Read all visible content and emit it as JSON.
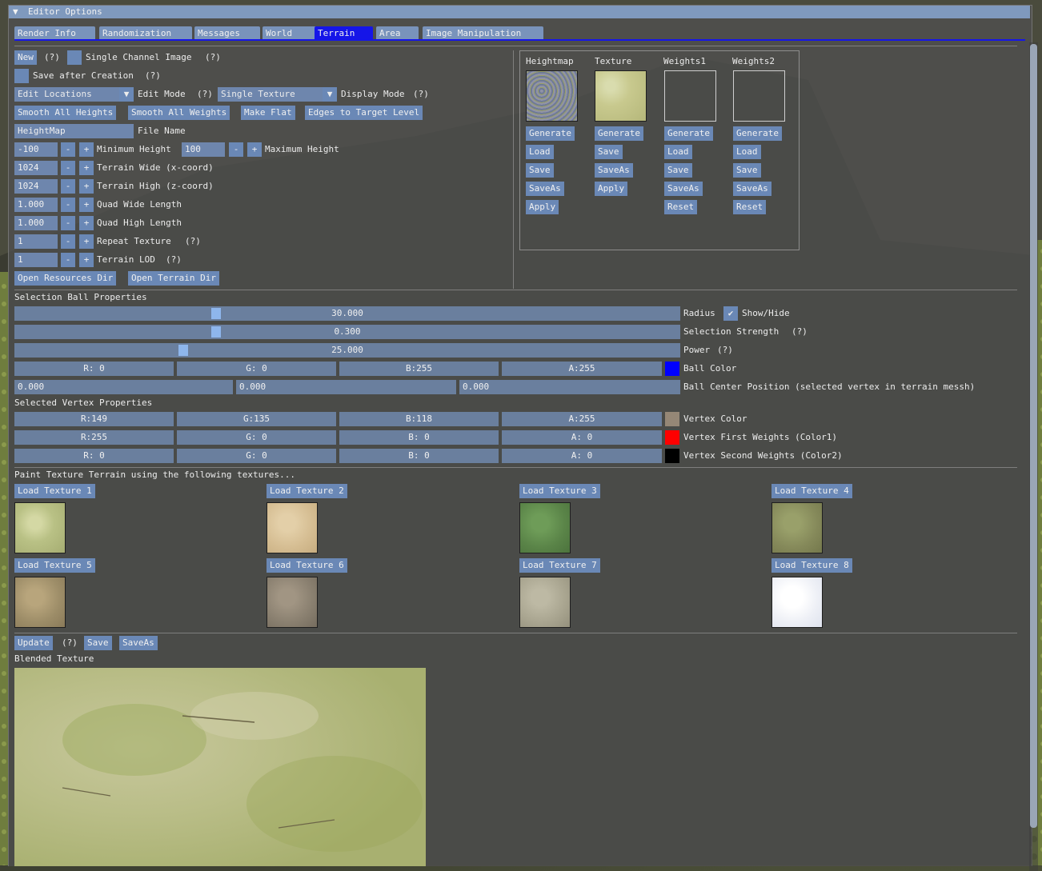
{
  "title": "Editor Options",
  "tabs": [
    "Render Info",
    "Randomization",
    "Messages",
    "World",
    "Terrain",
    "Area",
    "Image Manipulation"
  ],
  "active_tab": "Terrain",
  "toolbar": {
    "new": "New",
    "help": "(?)",
    "single_channel": "Single Channel Image",
    "save_after": "Save after Creation",
    "edit_mode_value": "Edit Locations",
    "edit_mode_label": "Edit Mode",
    "display_mode_value": "Single Texture",
    "display_mode_label": "Display Mode",
    "smooth_heights": "Smooth All Heights",
    "smooth_weights": "Smooth All Weights",
    "make_flat": "Make Flat",
    "edges": "Edges to Target Level",
    "file_name_value": "HeightMap",
    "file_name_label": "File Name",
    "minus": "-",
    "plus": "+"
  },
  "params": {
    "min_height": {
      "value": "-100",
      "label": "Minimum Height"
    },
    "max_height": {
      "value": "100",
      "label": "Maximum Height"
    },
    "wide": {
      "value": "1024",
      "label": "Terrain Wide (x-coord)"
    },
    "high": {
      "value": "1024",
      "label": "Terrain High (z-coord)"
    },
    "quad_wide": {
      "value": "1.000",
      "label": "Quad Wide Length"
    },
    "quad_high": {
      "value": "1.000",
      "label": "Quad High Length"
    },
    "repeat": {
      "value": "1",
      "label": "Repeat Texture"
    },
    "lod": {
      "value": "1",
      "label": "Terrain LOD"
    }
  },
  "dirs": {
    "resources": "Open Resources Dir",
    "terrain": "Open Terrain Dir"
  },
  "maps": {
    "heightmap": {
      "title": "Heightmap",
      "buttons": [
        "Generate",
        "Load",
        "Save",
        "SaveAs",
        "Apply"
      ]
    },
    "texture": {
      "title": "Texture",
      "buttons": [
        "Generate",
        "Save",
        "SaveAs",
        "Apply"
      ]
    },
    "weights1": {
      "title": "Weights1",
      "buttons": [
        "Generate",
        "Load",
        "Save",
        "SaveAs",
        "Reset"
      ]
    },
    "weights2": {
      "title": "Weights2",
      "buttons": [
        "Generate",
        "Load",
        "Save",
        "SaveAs",
        "Reset"
      ]
    }
  },
  "ball": {
    "header": "Selection Ball Properties",
    "radius": {
      "value": "30.000",
      "label": "Radius",
      "level": 0.3
    },
    "show_hide": "Show/Hide",
    "strength": {
      "value": "0.300",
      "label": "Selection Strength",
      "level": 0.3
    },
    "power": {
      "value": "25.000",
      "label": "Power",
      "level": 0.25
    },
    "color": {
      "r": "R:  0",
      "g": "G:  0",
      "b": "B:255",
      "a": "A:255",
      "label": "Ball Color",
      "hex": "#0000ff"
    },
    "center": {
      "x": "0.000",
      "y": "0.000",
      "z": "0.000",
      "label": "Ball Center Position (selected vertex in terrain messh)"
    }
  },
  "vertex": {
    "header": "Selected Vertex Properties",
    "color": {
      "r": "R:149",
      "g": "G:135",
      "b": "B:118",
      "a": "A:255",
      "label": "Vertex Color",
      "hex": "#958776"
    },
    "first": {
      "r": "R:255",
      "g": "G:  0",
      "b": "B:  0",
      "a": "A:  0",
      "label": "Vertex First Weights (Color1)",
      "hex": "#ff0000"
    },
    "second": {
      "r": "R:  0",
      "g": "G:  0",
      "b": "B:  0",
      "a": "A:  0",
      "label": "Vertex Second Weights (Color2)",
      "hex": "#000000"
    }
  },
  "paint": {
    "header": "Paint Texture Terrain using the following textures...",
    "textures": [
      "Load Texture 1",
      "Load Texture 2",
      "Load Texture 3",
      "Load Texture 4",
      "Load Texture 5",
      "Load Texture 6",
      "Load Texture 7",
      "Load Texture 8"
    ]
  },
  "blend": {
    "update": "Update",
    "save": "Save",
    "save_as": "SaveAs",
    "label": "Blended Texture"
  },
  "colors": {
    "tab_active": "#1515e8",
    "button": "#6a88b6",
    "title": "#7f99bd"
  }
}
